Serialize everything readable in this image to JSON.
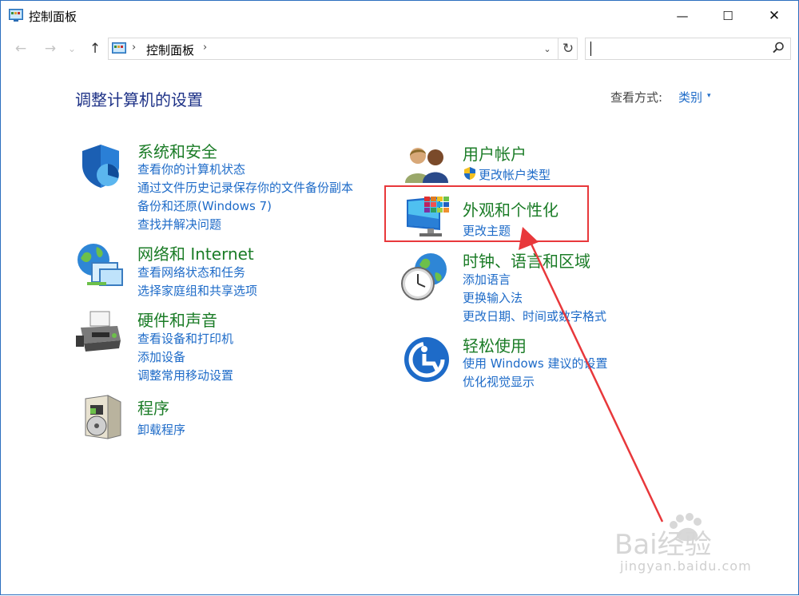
{
  "window": {
    "title": "控制面板",
    "minimize": "—",
    "maximize": "☐",
    "close": "✕"
  },
  "nav": {
    "back": "←",
    "forward": "→",
    "recent": "⌄",
    "up": "↑"
  },
  "address": {
    "sep": "›",
    "crumb": "控制面板",
    "crumb_sep": "›",
    "dropdown": "⌄",
    "refresh": "↻"
  },
  "search": {
    "placeholder": ""
  },
  "page": {
    "title": "调整计算机的设置",
    "view_label": "查看方式:",
    "view_value": "类别",
    "view_arrow": "▾"
  },
  "categories": [
    {
      "title": "系统和安全",
      "icon": "shield-icon",
      "links": [
        "查看你的计算机状态",
        "通过文件历史记录保存你的文件备份副本",
        "备份和还原(Windows 7)",
        "查找并解决问题"
      ]
    },
    {
      "title": "网络和 Internet",
      "icon": "network-icon",
      "links": [
        "查看网络状态和任务",
        "选择家庭组和共享选项"
      ]
    },
    {
      "title": "硬件和声音",
      "icon": "printer-icon",
      "links": [
        "查看设备和打印机",
        "添加设备",
        "调整常用移动设置"
      ]
    },
    {
      "title": "程序",
      "icon": "programs-icon",
      "links": [
        "卸载程序"
      ]
    },
    {
      "title": "用户帐户",
      "icon": "users-icon",
      "links": [
        "更改帐户类型"
      ]
    },
    {
      "title": "外观和个性化",
      "icon": "display-icon",
      "links": [
        "更改主题"
      ]
    },
    {
      "title": "时钟、语言和区域",
      "icon": "clock-globe-icon",
      "links": [
        "添加语言",
        "更换输入法",
        "更改日期、时间或数字格式"
      ]
    },
    {
      "title": "轻松使用",
      "icon": "ease-of-access-icon",
      "links": [
        "使用 Windows 建议的设置",
        "优化视觉显示"
      ]
    }
  ],
  "watermark": {
    "logo": "Bai经验",
    "url": "jingyan.baidu.com"
  },
  "colors": {
    "category_title": "#1b7c27",
    "link": "#1e6bc8",
    "page_title": "#1e3287",
    "highlight": "#e8383b"
  }
}
